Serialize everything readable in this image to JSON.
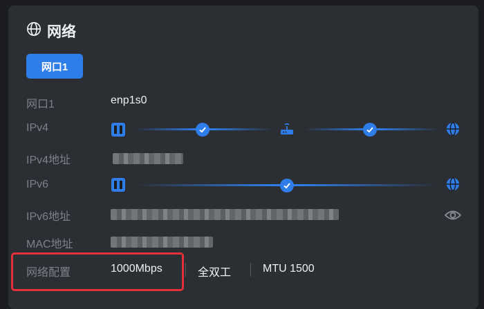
{
  "section": {
    "title": "网络"
  },
  "tabs": [
    {
      "label": "网口1",
      "active": true
    }
  ],
  "rows": {
    "iface": {
      "label": "网口1",
      "value": "enp1s0"
    },
    "ipv4": {
      "label": "IPv4"
    },
    "ipv4_addr": {
      "label": "IPv4地址"
    },
    "ipv6": {
      "label": "IPv6"
    },
    "ipv6_addr": {
      "label": "IPv6地址"
    },
    "mac": {
      "label": "MAC地址"
    },
    "config": {
      "label": "网络配置",
      "speed": "1000Mbps",
      "duplex": "全双工",
      "mtu": "MTU 1500"
    }
  },
  "icons": {
    "section": "globe-icon",
    "port": "ethernet-port-icon",
    "router": "router-icon",
    "internet": "globe-icon",
    "check": "check-icon",
    "reveal": "eye-icon"
  },
  "colors": {
    "accent": "#2f7de8",
    "highlight": "#e5303a",
    "card": "#2b2e33",
    "background": "#1a1c20"
  }
}
